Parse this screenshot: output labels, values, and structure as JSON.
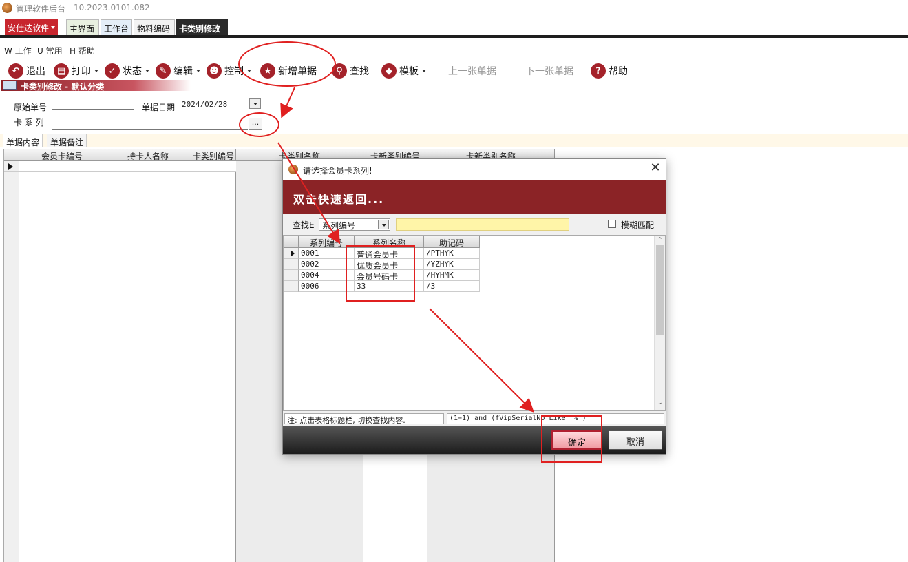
{
  "window": {
    "title": "管理软件后台",
    "version": "10.2023.0101.082"
  },
  "brand": {
    "label": "安仕达软件"
  },
  "tabs": [
    {
      "label": "主界面"
    },
    {
      "label": "工作台"
    },
    {
      "label": "物料编码"
    },
    {
      "label": "卡类别修改"
    }
  ],
  "menu": [
    {
      "label": "W 工作"
    },
    {
      "label": "U 常用"
    },
    {
      "label": "H 帮助"
    }
  ],
  "toolbar": {
    "exit": "退出",
    "print": "打印",
    "status": "状态",
    "edit": "编辑",
    "control": "控制",
    "new_doc": "新增单据",
    "find": "查找",
    "template": "模板",
    "prev_doc": "上一张单据",
    "next_doc": "下一张单据",
    "help": "帮助"
  },
  "form": {
    "header": "卡类别修改 - 默认分类",
    "orig_no_label": "原始单号",
    "date_label": "单据日期",
    "date_value": "2024/02/28",
    "series_label": "卡 系 列",
    "ellipsis": "..."
  },
  "subtabs": [
    {
      "label": "单据内容"
    },
    {
      "label": "单据备注"
    }
  ],
  "grid": {
    "columns": [
      "会员卡编号",
      "持卡人名称",
      "卡类别编号",
      "卡类别名称",
      "卡新类别编号",
      "卡新类别名称"
    ]
  },
  "dialog": {
    "title": "请选择会员卡系列!",
    "close": "✕",
    "banner": "双击快速返回...",
    "search_label": "查找E",
    "search_field": "系列编号",
    "search_value": "",
    "fuzzy_label": "模糊匹配",
    "columns": [
      "系列编号",
      "系列名称",
      "助记码"
    ],
    "rows": [
      {
        "code": "0001",
        "name": "普通会员卡",
        "mnemonic": "/PTHYK"
      },
      {
        "code": "0002",
        "name": "优质会员卡",
        "mnemonic": "/YZHYK"
      },
      {
        "code": "0004",
        "name": "会员号码卡",
        "mnemonic": "/HYHMK"
      },
      {
        "code": "0006",
        "name": "33",
        "mnemonic": "/3"
      }
    ],
    "status_hint": "注: 点击表格标题栏, 切换查找内容.",
    "status_query": "(1=1) and (fVipSerialNo Like '%')",
    "ok": "确定",
    "cancel": "取消"
  },
  "colors": {
    "accent": "#8b2326",
    "annotation": "#e02020",
    "brand": "#c8262e"
  }
}
